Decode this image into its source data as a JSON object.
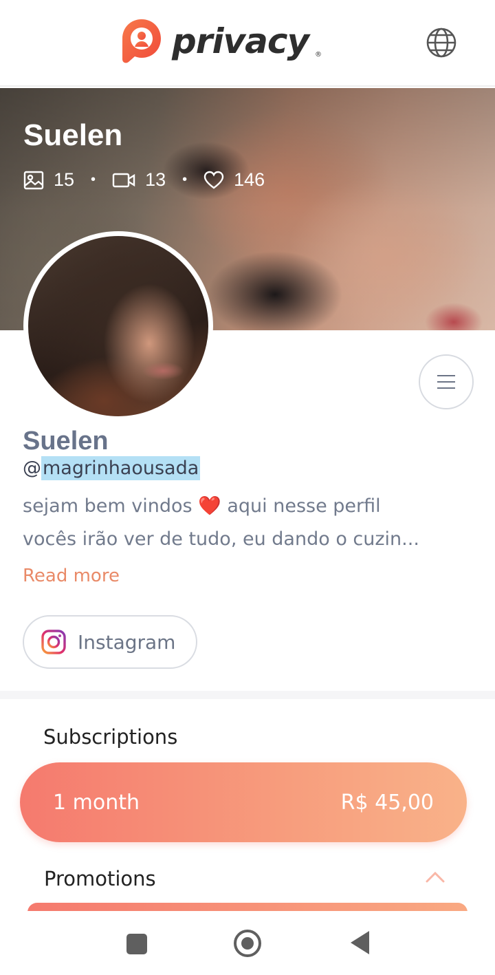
{
  "header": {
    "logo_text": "privacy",
    "logo_reg": "®",
    "globe_icon": "globe-icon"
  },
  "cover": {
    "name": "Suelen",
    "stats": {
      "images": "15",
      "videos": "13",
      "likes": "146",
      "separator": "•"
    }
  },
  "profile": {
    "name": "Suelen",
    "handle_at": "@",
    "handle": "magrinhaousada",
    "bio_line1_a": "sejam bem vindos ",
    "bio_heart": "❤️",
    "bio_line1_b": " aqui nesse perfil",
    "bio_line2": "vocês irão ver de tudo, eu dando o cuzin...",
    "read_more": "Read more"
  },
  "social": {
    "instagram_label": "Instagram"
  },
  "subscriptions": {
    "title": "Subscriptions",
    "plan_duration": "1 month",
    "plan_price": "R$ 45,00"
  },
  "promotions": {
    "title": "Promotions"
  },
  "colors": {
    "accent": "#f57a6e",
    "link": "#e98a68",
    "name": "#68738a",
    "selection": "#b4e0f5"
  }
}
